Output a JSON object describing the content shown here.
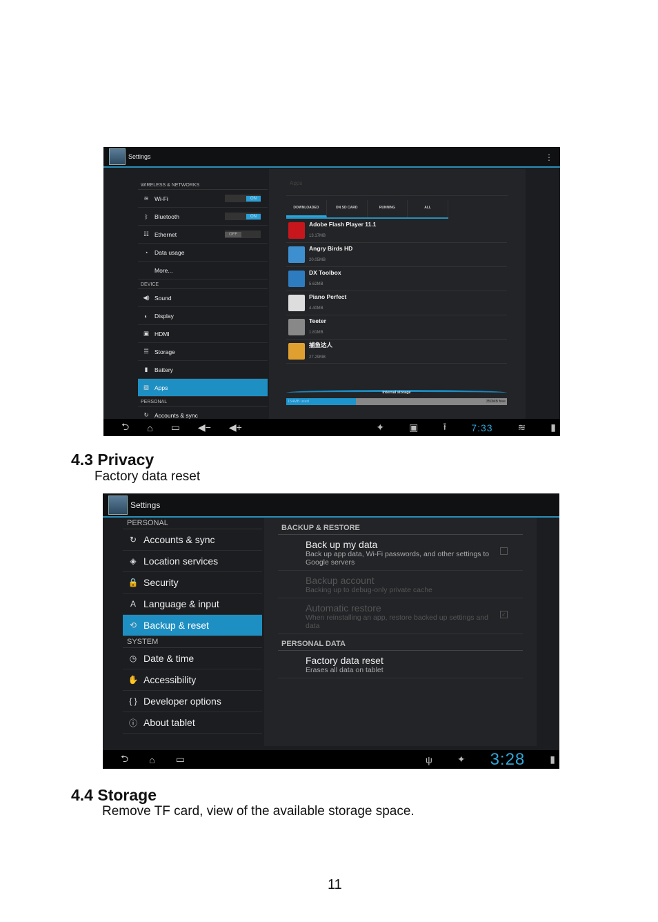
{
  "shot1": {
    "title": "Settings",
    "sidebar": {
      "headers": [
        "WIRELESS & NETWORKS",
        "DEVICE",
        "PERSONAL"
      ],
      "items": [
        {
          "label": "Wi-Fi",
          "icon": "wifi-icon",
          "glyph": "≋",
          "toggle": "ON"
        },
        {
          "label": "Bluetooth",
          "icon": "bluetooth-icon",
          "glyph": "ᛒ",
          "toggle": "ON"
        },
        {
          "label": "Ethernet",
          "icon": "ethernet-icon",
          "glyph": "☷",
          "toggle": "OFF"
        },
        {
          "label": "Data usage",
          "icon": "data-usage-icon",
          "glyph": "◔"
        },
        {
          "label": "More...",
          "icon": "",
          "glyph": ""
        },
        {
          "label": "Sound",
          "icon": "speaker-icon",
          "glyph": "◀)"
        },
        {
          "label": "Display",
          "icon": "brightness-icon",
          "glyph": "◐"
        },
        {
          "label": "HDMI",
          "icon": "hdmi-icon",
          "glyph": "▣"
        },
        {
          "label": "Storage",
          "icon": "storage-icon",
          "glyph": "☰"
        },
        {
          "label": "Battery",
          "icon": "battery-icon",
          "glyph": "▮"
        },
        {
          "label": "Apps",
          "icon": "apps-icon",
          "glyph": "▨",
          "selected": true
        },
        {
          "label": "Accounts & sync",
          "icon": "sync-icon",
          "glyph": "↻"
        }
      ]
    },
    "panel_title": "Apps",
    "tabs": [
      "DOWNLOADED",
      "ON SD CARD",
      "RUNNING",
      "ALL"
    ],
    "active_tab": "DOWNLOADED",
    "apps": [
      {
        "name": "Adobe Flash Player 11.1",
        "size": "13.17MB",
        "color": "#c8161d"
      },
      {
        "name": "Angry Birds HD",
        "size": "20.05MB",
        "color": "#3d8fd0"
      },
      {
        "name": "DX Toolbox",
        "size": "5.62MB",
        "color": "#2e7cc0"
      },
      {
        "name": "Piano Perfect",
        "size": "4.40MB",
        "color": "#dddddd"
      },
      {
        "name": "Teeter",
        "size": "1.81MB",
        "color": "#888888"
      },
      {
        "name": "捕鱼达人",
        "size": "27.29MB",
        "color": "#e0a030"
      }
    ],
    "storage": {
      "label": "Internal storage",
      "used": "154MB used",
      "free": "350MB free",
      "used_fraction": 0.31
    },
    "clock": "7:33"
  },
  "doc": {
    "heading1": "4.3 Privacy",
    "sub1": "Factory data reset",
    "heading2": "4.4 Storage",
    "sub2": "Remove TF card, view of the available storage space.",
    "page_number": "11"
  },
  "shot2": {
    "title": "Settings",
    "sidebar": {
      "headers": [
        "PERSONAL",
        "SYSTEM"
      ],
      "items": [
        {
          "label": "Accounts & sync",
          "icon": "sync-icon",
          "glyph": "↻"
        },
        {
          "label": "Location services",
          "icon": "location-icon",
          "glyph": "◈"
        },
        {
          "label": "Security",
          "icon": "lock-icon",
          "glyph": "🔒"
        },
        {
          "label": "Language & input",
          "icon": "language-icon",
          "glyph": "A"
        },
        {
          "label": "Backup & reset",
          "icon": "backup-icon",
          "glyph": "⟲",
          "selected": true
        },
        {
          "label": "Date & time",
          "icon": "clock-icon",
          "glyph": "◷"
        },
        {
          "label": "Accessibility",
          "icon": "hand-icon",
          "glyph": "✋"
        },
        {
          "label": "Developer options",
          "icon": "braces-icon",
          "glyph": "{ }"
        },
        {
          "label": "About tablet",
          "icon": "info-icon",
          "glyph": "ⓘ"
        }
      ]
    },
    "sections": [
      "BACKUP & RESTORE",
      "PERSONAL DATA"
    ],
    "prefs": [
      {
        "title": "Back up my data",
        "summary": "Back up app data, Wi-Fi passwords, and other settings to Google servers",
        "checkbox": false
      },
      {
        "title": "Backup account",
        "summary": "Backing up to debug-only private cache",
        "disabled": true
      },
      {
        "title": "Automatic restore",
        "summary": "When reinstalling an app, restore backed up settings and data",
        "checkbox": true,
        "disabled": true
      },
      {
        "title": "Factory data reset",
        "summary": "Erases all data on tablet"
      }
    ],
    "clock": "3:28"
  }
}
